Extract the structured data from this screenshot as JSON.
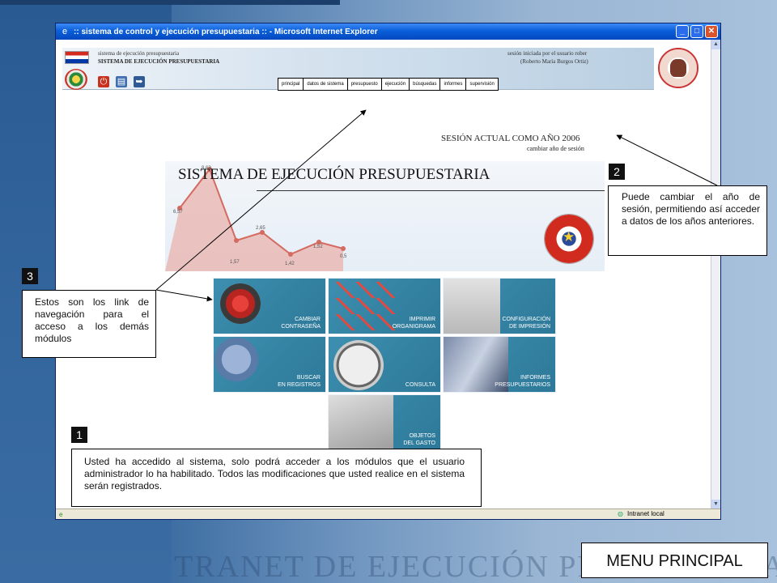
{
  "window": {
    "title": ":: sistema de control y ejecución presupuestaria :: - Microsoft Internet Explorer",
    "minimize": "_",
    "maximize": "□",
    "close": "✕"
  },
  "header": {
    "subtitle": "sistema de ejecución presupuestaria",
    "title": "SISTEMA DE EJECUCIÓN PRESUPUESTARIA",
    "session_user": "sesión iniciada por el usuario rober",
    "session_name": "(Roberto María Burgos Ortiz)",
    "nav": [
      "principal",
      "datos de sistema",
      "presupuesto",
      "ejecución",
      "búsquedas",
      "informes",
      "supervisión"
    ]
  },
  "session": {
    "year_label": "SESIÓN ACTUAL COMO AÑO 2006",
    "change_link": "cambiar año de sesión"
  },
  "banner": {
    "title": "SISTEMA DE EJECUCIÓN PRESUPUESTARIA",
    "chart_labels": [
      "6,57",
      "8,63",
      "1,57",
      "2,65",
      "1,42",
      "1,52",
      "0,5"
    ]
  },
  "modules": [
    {
      "label": "CAMBIAR\nCONTRASEÑA"
    },
    {
      "label": "IMPRIMIR\nORGANIGRAMA"
    },
    {
      "label": "CONFIGURACIÓN\nDE IMPRESIÓN"
    },
    {
      "label": "BUSCAR\nEN REGISTROS"
    },
    {
      "label": "CONSULTA"
    },
    {
      "label": "INFORMES\nPRESUPUESTARIOS"
    },
    {
      "label": "OBJETOS\nDEL GASTO"
    }
  ],
  "statusbar": {
    "zone": "Intranet local"
  },
  "callouts": {
    "c1": {
      "num": "1",
      "text": "Usted ha accedido al sistema, solo podrá acceder a los módulos que el usuario administrador lo ha habilitado. Todos las modificaciones que usted realice en el sistema serán registrados."
    },
    "c2": {
      "num": "2",
      "text": "Puede cambiar el año de sesión, permitiendo así acceder a datos de los años anteriores."
    },
    "c3": {
      "num": "3",
      "text": "Estos son los link de navegación para el acceso a los demás módulos"
    }
  },
  "menu_principal": "MENU PRINCIPAL",
  "background_text": "TRANET DE EJECUCIÓN PRESUPUESTARIA"
}
